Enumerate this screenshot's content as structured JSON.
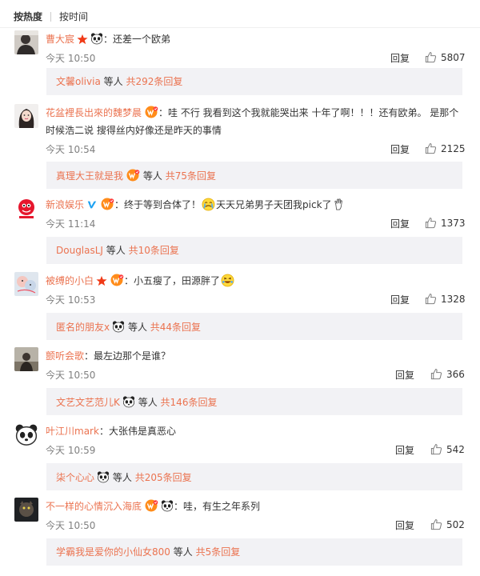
{
  "tabs": [
    {
      "label": "按热度"
    },
    {
      "label": "按时间"
    }
  ],
  "reply_label": "回复",
  "sub_mid_text": "等人",
  "comments": [
    {
      "user": "曹大宸",
      "text_before": "：还差一个欧弟",
      "text_after": "",
      "time": "今天 10:50",
      "likes": "5807",
      "sub_user": "文馨olivia",
      "sub_total": "共292条回复"
    },
    {
      "user": "花盆裡長出來的魏梦晨",
      "text_before": "：哇 不行 我看到这个我就能哭出来  十年了啊！！！还有欧弟。 是那个时候浩二说 搜得丝内好像还是昨天的事情",
      "text_after": "",
      "time": "今天 10:54",
      "likes": "2125",
      "sub_user": "真理大王就是我",
      "sub_total": "共75条回复"
    },
    {
      "user": "新浪娱乐",
      "text_before": "：终于等到合体了！",
      "text_after": "天天兄弟男子天团我pick了",
      "time": "今天 11:14",
      "likes": "1373",
      "sub_user": "DouglasLJ",
      "sub_total": "共10条回复"
    },
    {
      "user": "被缚的小白",
      "text_before": "：小五瘦了，田源胖了",
      "text_after": "",
      "time": "今天 10:53",
      "likes": "1328",
      "sub_user": "匿名的朋友x",
      "sub_total": "共44条回复"
    },
    {
      "user": "颤听会歌",
      "text_before": "：最左边那个是谁？",
      "text_after": "",
      "time": "今天 10:50",
      "likes": "366",
      "sub_user": "文艺文艺范儿K",
      "sub_total": "共146条回复"
    },
    {
      "user": "叶江川mark",
      "text_before": "：大张伟是真恶心",
      "text_after": "",
      "time": "今天 10:59",
      "likes": "542",
      "sub_user": "柒个心心",
      "sub_total": "共205条回复"
    },
    {
      "user": "不一样的心情沉入海底",
      "text_before": "：哇，有生之年系列",
      "text_after": "",
      "time": "今天 10:50",
      "likes": "502",
      "sub_user": "学霸我是爱你的小仙女800",
      "sub_total": "共5条回复"
    }
  ],
  "colors": {
    "username": "#eb7350",
    "sub_background": "#f2f2f5",
    "time": "#808080",
    "verified_blue": "#1da1f2",
    "star_red": "#f03a17"
  },
  "icons": [
    "star-icon",
    "panda-icon",
    "vip-badge-icon",
    "verified-icon",
    "crying-emoji-icon",
    "laughing-emoji-icon",
    "hand-emoji-icon",
    "thumbs-up-icon"
  ]
}
